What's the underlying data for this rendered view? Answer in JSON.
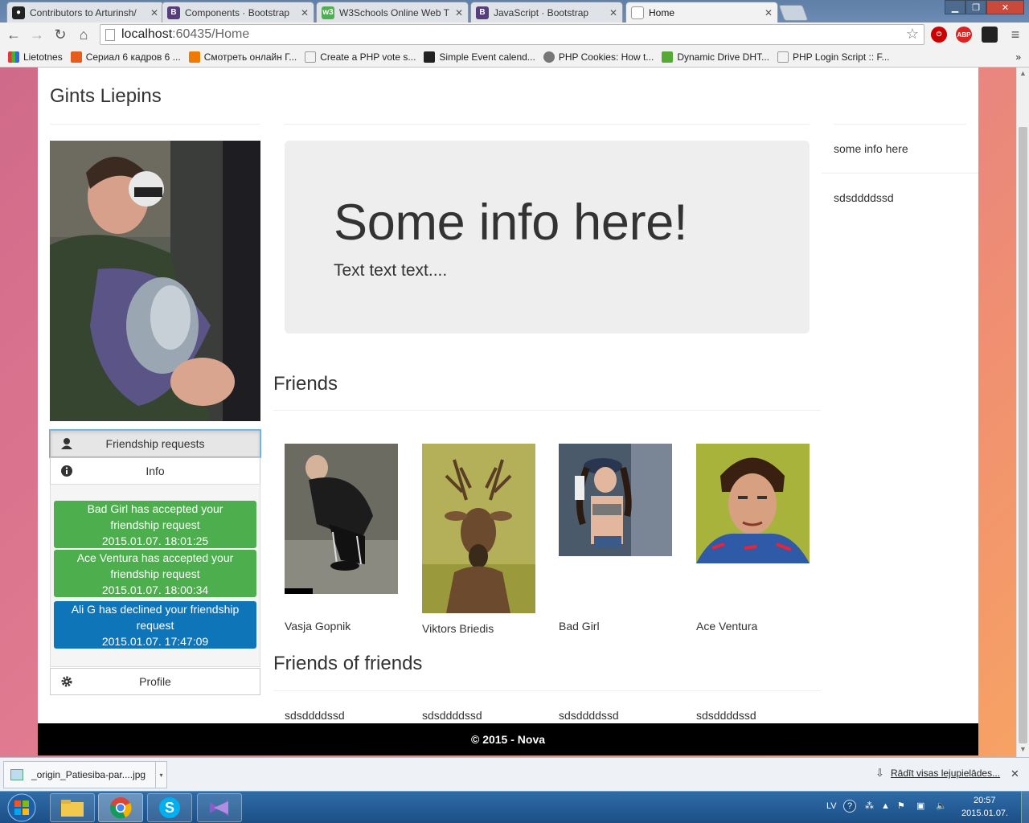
{
  "browser": {
    "tabs": [
      {
        "label": "Contributors to Arturinsh/",
        "icon": "github-icon",
        "color": "#222222"
      },
      {
        "label": "Components · Bootstrap",
        "icon": "bootstrap-icon",
        "color": "#563d7c"
      },
      {
        "label": "W3Schools Online Web T",
        "icon": "w3schools-icon",
        "color": "#4caf50"
      },
      {
        "label": "JavaScript · Bootstrap",
        "icon": "bootstrap-icon",
        "color": "#563d7c"
      },
      {
        "label": "Home",
        "icon": "page-icon",
        "color": "#ffffff"
      }
    ],
    "active_tab": 4,
    "url_host": "localhost",
    "url_rest": ":60435/Home",
    "bookmarks": [
      {
        "label": "Lietotnes",
        "icon": "apps-icon"
      },
      {
        "label": "Сериал 6 кадров 6 ...",
        "icon": "bookmark-icon"
      },
      {
        "label": "Смотреть онлайн Г...",
        "icon": "bookmark-icon"
      },
      {
        "label": "Create a PHP vote s...",
        "icon": "page-icon"
      },
      {
        "label": "Simple Event calend...",
        "icon": "bookmark-icon"
      },
      {
        "label": "PHP Cookies: How t...",
        "icon": "bookmark-icon"
      },
      {
        "label": "Dynamic Drive DHT...",
        "icon": "bookmark-icon"
      },
      {
        "label": "PHP Login Script :: F...",
        "icon": "page-icon"
      }
    ],
    "extensions": [
      "ABP"
    ]
  },
  "page": {
    "site_title": "Gints Liepins",
    "jumbotron": {
      "heading": "Some info here!",
      "text": "Text text text...."
    },
    "sidebar_buttons": {
      "friendship_requests": "Friendship requests",
      "info": "Info",
      "profile": "Profile"
    },
    "notifications": [
      {
        "line1": "Bad Girl has accepted your",
        "line2": "friendship request",
        "time": "2015.01.07. 18:01:25",
        "kind": "success"
      },
      {
        "line1": "Ace Ventura has accepted your",
        "line2": "friendship request",
        "time": "2015.01.07. 18:00:34",
        "kind": "success"
      },
      {
        "line1": "Ali G has declined your friendship",
        "line2": "request",
        "time": "2015.01.07. 17:47:09",
        "kind": "info"
      }
    ],
    "friends_title": "Friends",
    "friends": [
      {
        "name": "Vasja Gopnik"
      },
      {
        "name": "Viktors Briedis"
      },
      {
        "name": "Bad Girl"
      },
      {
        "name": "Ace Ventura"
      }
    ],
    "fof_title": "Friends of friends",
    "friends_of_friends": [
      "sdsddddssd",
      "sdsddddssd",
      "sdsddddssd",
      "sdsddddssd"
    ],
    "right_sidebar": [
      "some info here",
      "sdsddddssd"
    ],
    "footer": "© 2015 - Nova"
  },
  "download_bar": {
    "file": "_origin_Patiesiba-par....jpg",
    "show_all": "Rādīt visas lejupielādes..."
  },
  "taskbar": {
    "lang": "LV",
    "time": "20:57",
    "date": "2015.01.07."
  }
}
